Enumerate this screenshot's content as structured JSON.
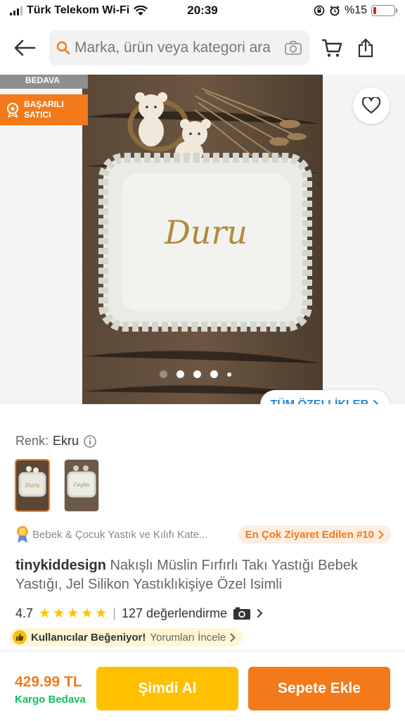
{
  "status_bar": {
    "carrier": "Türk Telekom Wi-Fi",
    "time": "20:39",
    "battery": "%15",
    "battery_level_percent": 15
  },
  "header": {
    "back_icon": "arrow-left-icon",
    "search_placeholder": "Marka, ürün veya kategori ara",
    "search_icon": "search-icon",
    "camera_icon": "camera-icon",
    "cart_icon": "cart-icon",
    "share_icon": "share-icon"
  },
  "gallery": {
    "badge_free": "BEDAVA",
    "badge_seller": "BAŞARILI SATICI",
    "photo_text": "Duru",
    "image_count": 5,
    "active_image": 1,
    "all_features": "TÜM ÖZELLİKLER"
  },
  "color": {
    "label": "Renk:",
    "value": "Ekru",
    "thumb_texts": [
      "Duru",
      "Ceylin"
    ]
  },
  "category": {
    "text": "Bebek & Çocuk Yastık ve Kılıfı Kate...",
    "most_visited": "En Çok Ziyaret Edilen #10"
  },
  "product": {
    "brand": "tinykiddesign",
    "title": "Nakışlı Müslin Fırfırlı Takı Yastığı Bebek Yastığı, Jel Silikon Yastıklıkişiye Özel Isimli"
  },
  "rating": {
    "score": "4.7",
    "stars": 4.7,
    "separator": "|",
    "reviews": "127 değerlendirme"
  },
  "liked": {
    "label": "Kullanıcılar Beğeniyor!",
    "link": "Yorumları İncele"
  },
  "footer": {
    "price": "429.99 TL",
    "cargo": "Kargo Bedava",
    "buy_now": "Şimdi Al",
    "add_to_cart": "Sepete Ekle"
  },
  "colors": {
    "accent": "#f27a1a",
    "buy_now": "#ffc000",
    "cargo_green": "#0bc15c",
    "link_blue": "#2a86d4"
  }
}
